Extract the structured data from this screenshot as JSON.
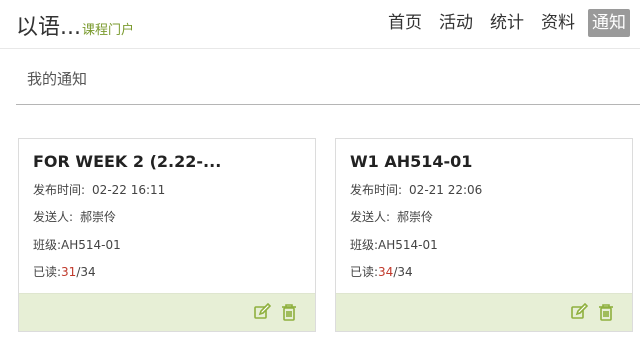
{
  "header": {
    "logo_main": "以语...",
    "logo_sub": "课程门户",
    "nav": [
      {
        "label": "首页"
      },
      {
        "label": "活动"
      },
      {
        "label": "统计"
      },
      {
        "label": "资料"
      },
      {
        "label": "通知"
      }
    ],
    "active_nav": "通知"
  },
  "page": {
    "title": "我的通知"
  },
  "notices": [
    {
      "title": "FOR WEEK 2 (2.22-...",
      "time_label": "发布时间:",
      "time": "02-22 16:11",
      "sender_label": "发送人:",
      "sender": "郝崇伶",
      "class_label": "班级:",
      "class": "AH514-01",
      "read_label": "已读:",
      "read": "31",
      "total": "/34"
    },
    {
      "title": "W1 AH514-01",
      "time_label": "发布时间:",
      "time": "02-21 22:06",
      "sender_label": "发送人:",
      "sender": "郝崇伶",
      "class_label": "班级:",
      "class": "AH514-01",
      "read_label": "已读:",
      "read": "34",
      "total": "/34"
    }
  ],
  "colors": {
    "accent_green": "#7a9a2e",
    "footer_bg": "#e7efd6",
    "read_red": "#c0392b",
    "active_nav_bg": "#9a9a9a"
  },
  "icons": {
    "edit": "edit-icon",
    "delete": "trash-icon"
  }
}
